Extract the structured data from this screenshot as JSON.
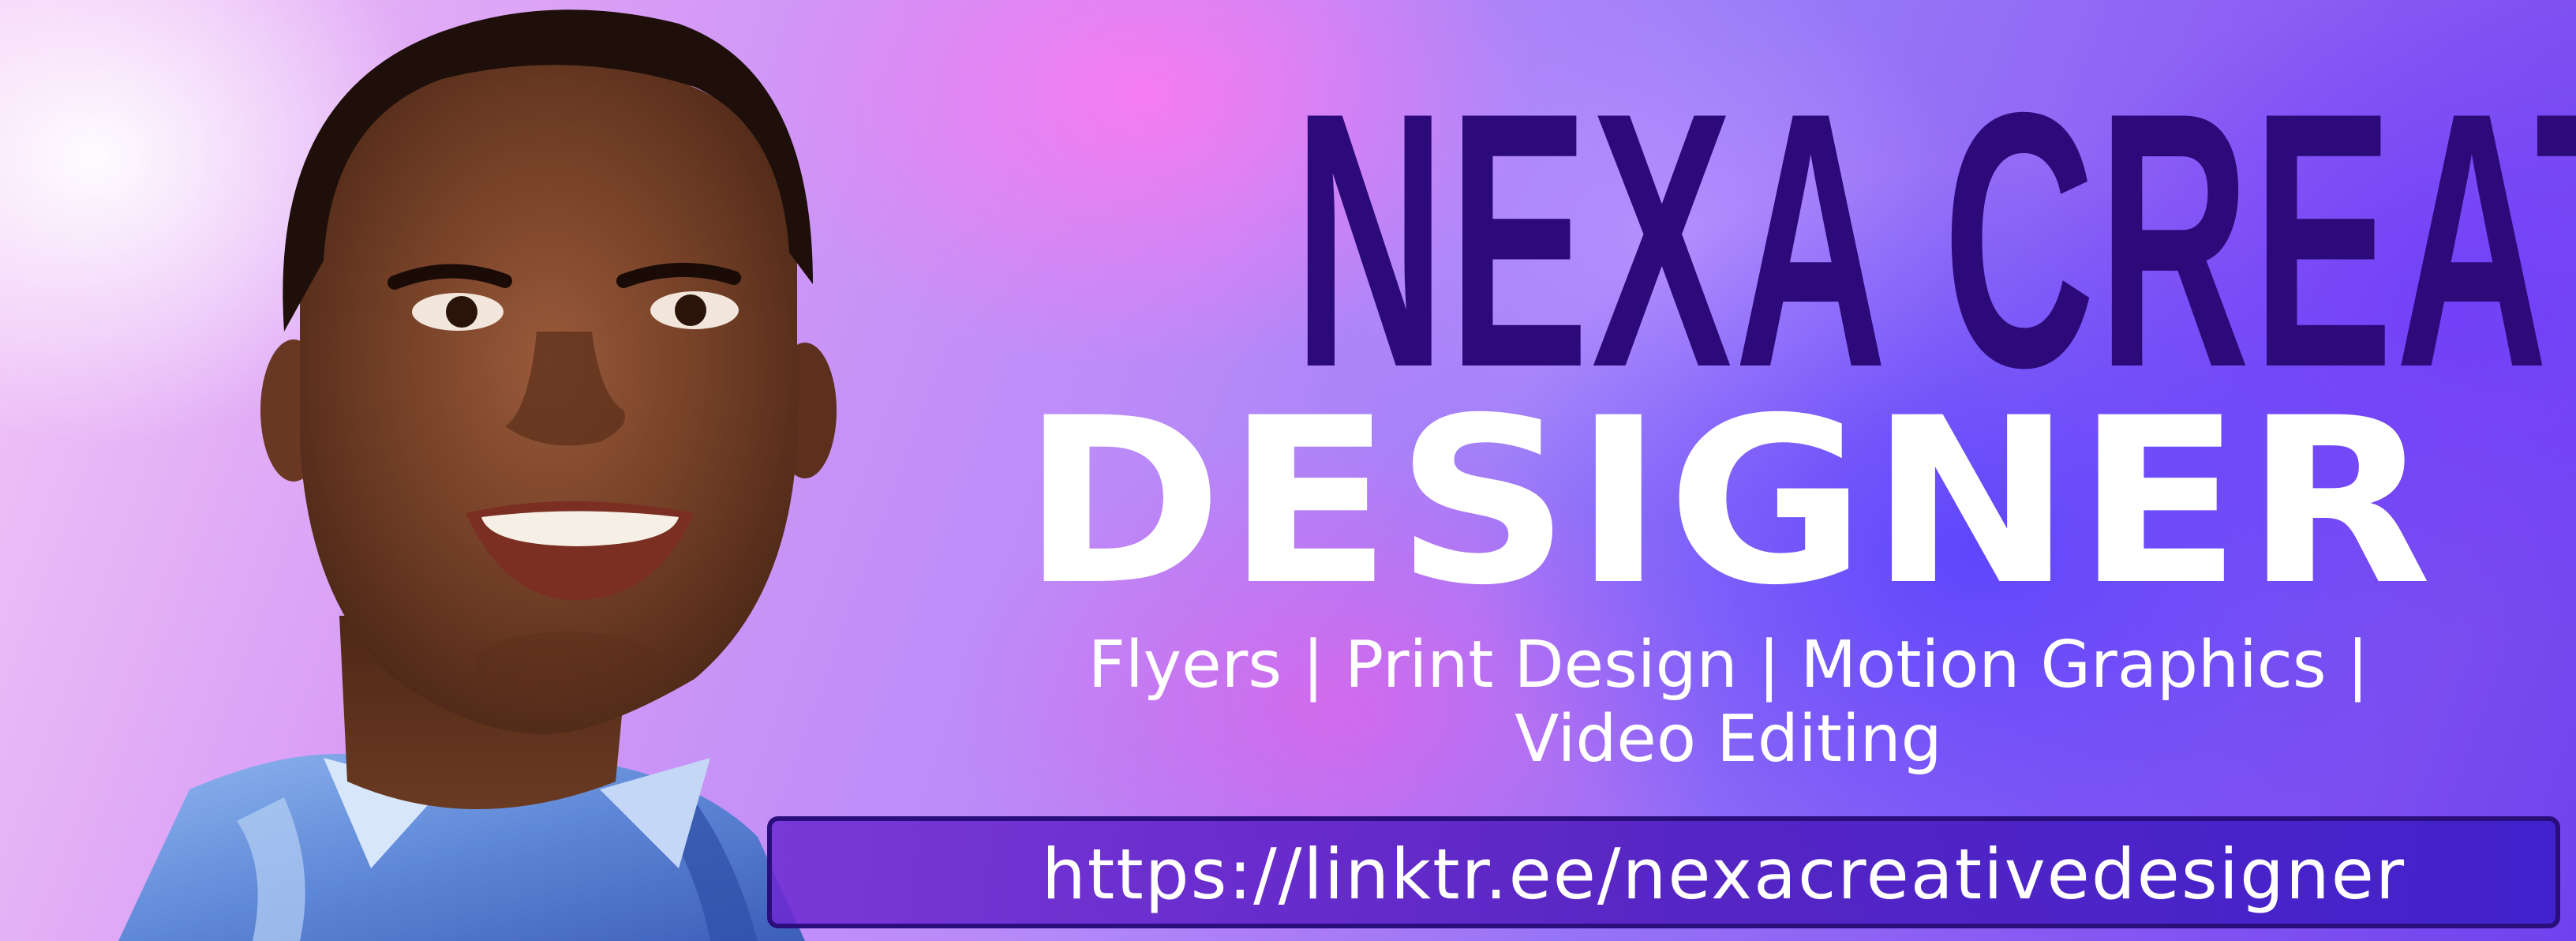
{
  "banner": {
    "title_line1": "NEXA CREATIVE",
    "title_line2": "DESIGNER",
    "services_line1": "Flyers | Print Design | Motion Graphics |",
    "services_line2": "Video Editing",
    "link": "https://linktr.ee/nexacreativedesigner"
  },
  "colors": {
    "title_dark": "#2c0a7a",
    "title_light": "#ffffff",
    "link_bar": "#4a1cb4",
    "link_border": "#2a0f7c"
  },
  "portrait": {
    "description_icon": "smiling-man-portrait"
  }
}
